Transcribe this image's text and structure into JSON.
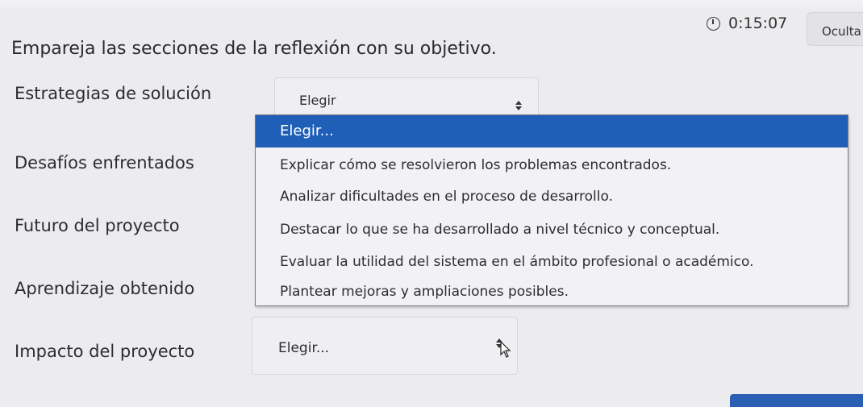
{
  "timer": {
    "icon": "clock-icon",
    "time": "0:15:07"
  },
  "hide_button": {
    "label": "Oculta"
  },
  "question": "Empareja las secciones de la reflexión con su objetivo.",
  "rows": [
    {
      "label": "Estrategias de solución",
      "selected": "Elegir"
    },
    {
      "label": "Desafíos enfrentados"
    },
    {
      "label": "Futuro del proyecto"
    },
    {
      "label": "Aprendizaje obtenido"
    },
    {
      "label": "Impacto del proyecto",
      "selected": "Elegir..."
    }
  ],
  "dropdown": {
    "options": [
      "Elegir...",
      "Explicar cómo se resolvieron los problemas encontrados.",
      "Analizar dificultades en el proceso de desarrollo.",
      "Destacar lo que se ha desarrollado a nivel técnico y conceptual.",
      "Evaluar la utilidad del sistema en el ámbito profesional o académico.",
      "Plantear mejoras y ampliaciones posibles."
    ],
    "highlighted_index": 0
  },
  "colors": {
    "highlight": "#1f5fb8",
    "background": "#ecebee",
    "accent_bar": "#2b5fb4"
  }
}
